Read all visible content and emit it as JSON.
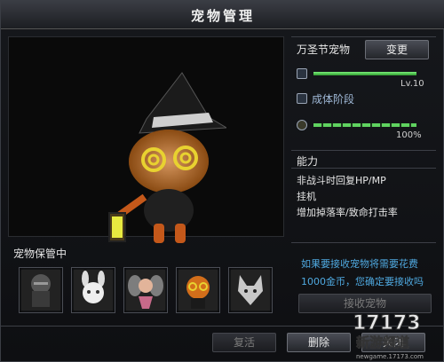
{
  "window": {
    "title": "宠物管理"
  },
  "storage": {
    "label": "宠物保管中",
    "slots": [
      {
        "name": "knight pet",
        "icon": "armored-knight-icon"
      },
      {
        "name": "rabbit pet",
        "icon": "white-rabbit-icon"
      },
      {
        "name": "fairy pet",
        "icon": "fairy-icon"
      },
      {
        "name": "pumpkin pet",
        "icon": "pumpkin-icon"
      },
      {
        "name": "fox pet",
        "icon": "silver-fox-icon"
      }
    ]
  },
  "pet": {
    "name": "万圣节宠物",
    "change_label": "变更",
    "level_text": "Lv.10",
    "level_progress": 1.0,
    "stage_text": "成体阶段",
    "stamina_text": "100%",
    "stamina_progress": 1.0
  },
  "ability": {
    "title": "能力",
    "lines": [
      "非战斗时回复HP/MP",
      "挂机",
      "增加掉落率/致命打击率"
    ]
  },
  "receive": {
    "line1": "如果要接收宠物将需要花费",
    "line2": "1000金币，您确定要接收吗",
    "button_label": "接收宠物"
  },
  "footer": {
    "revive_label": "复活",
    "delete_label": "删除",
    "close_label": "关闭"
  },
  "watermark": {
    "brand": "17173",
    "subtitle": "新游频道",
    "url": "newgame.17173.com"
  },
  "colors": {
    "bar_green": "#5fd35f",
    "info_blue": "#4fa9e0",
    "stage_blue": "#9fb8d6"
  }
}
